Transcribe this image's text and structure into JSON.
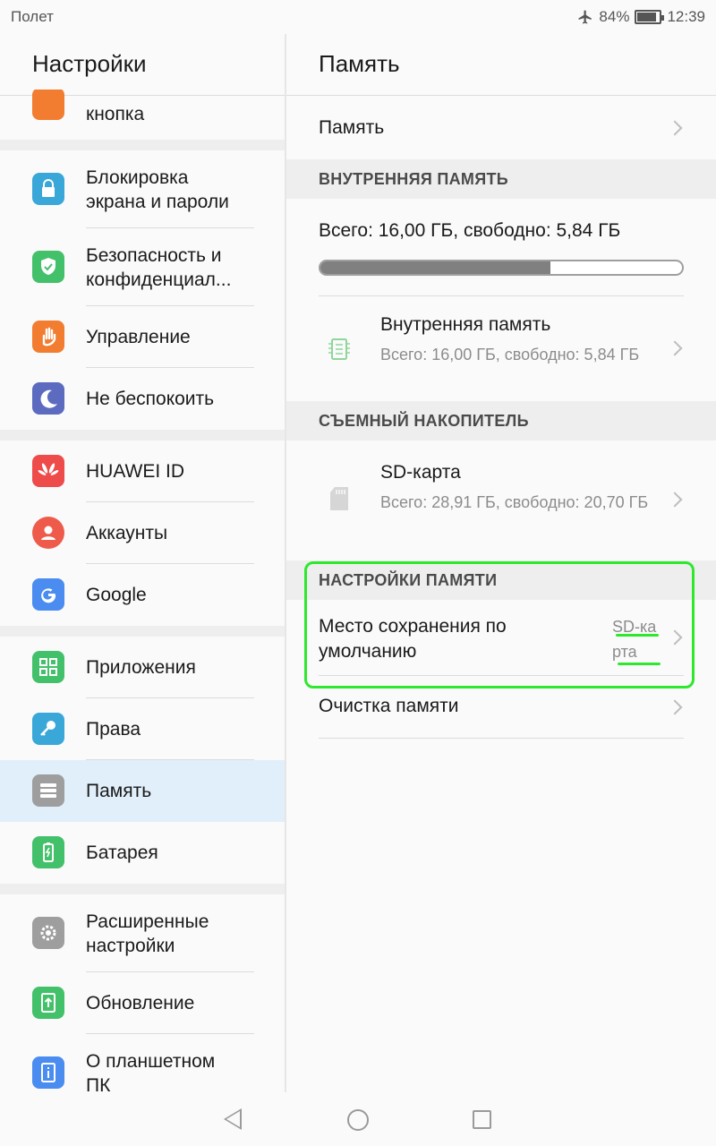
{
  "status_bar": {
    "left_text": "Полет",
    "battery": "84%",
    "time": "12:39",
    "battery_level": 0.84
  },
  "left_pane": {
    "title": "Настройки",
    "partial_item_label": "кнопка",
    "groups": [
      [
        {
          "label_line1": "Блокировка",
          "label_line2": "экрана и пароли",
          "icon": "lock-icon",
          "color": "#3aa7d9"
        },
        {
          "label_line1": "Безопасность и",
          "label_line2": "конфиденциал...",
          "icon": "shield-check-icon",
          "color": "#43c16a"
        },
        {
          "label": "Управление",
          "icon": "hand-icon",
          "color": "#f27c30"
        },
        {
          "label": "Не беспокоить",
          "icon": "moon-icon",
          "color": "#5c6bc0"
        }
      ],
      [
        {
          "label": "HUAWEI ID",
          "icon": "huawei-logo-icon",
          "color": "#ee4b4b"
        },
        {
          "label": "Аккаунты",
          "icon": "account-icon",
          "color": "#ee5b4b"
        },
        {
          "label": "Google",
          "icon": "google-icon",
          "color": "#4a8cf0"
        }
      ],
      [
        {
          "label": "Приложения",
          "icon": "apps-grid-icon",
          "color": "#43c16a"
        },
        {
          "label": "Права",
          "icon": "key-icon",
          "color": "#3aa7d9"
        },
        {
          "label": "Память",
          "icon": "storage-icon",
          "color": "#9e9e9e",
          "selected": true
        },
        {
          "label": "Батарея",
          "icon": "battery-icon",
          "color": "#43c16a"
        }
      ],
      [
        {
          "label_line1": "Расширенные",
          "label_line2": "настройки",
          "icon": "gear-icon",
          "color": "#9e9e9e"
        },
        {
          "label": "Обновление",
          "icon": "update-icon",
          "color": "#43c16a"
        },
        {
          "label_line1": "О планшетном",
          "label_line2": "ПК",
          "icon": "info-icon",
          "color": "#4a8cf0"
        }
      ]
    ]
  },
  "right_pane": {
    "title": "Память",
    "memory_row": "Память",
    "internal_header": "ВНУТРЕННЯЯ ПАМЯТЬ",
    "internal_summary": "Всего: 16,00 ГБ, свободно: 5,84 ГБ",
    "internal_used_fraction": 0.635,
    "internal_item_title": "Внутренняя память",
    "internal_item_sub": "Всего: 16,00 ГБ, свободно: 5,84 ГБ",
    "removable_header": "СЪЕМНЫЙ НАКОПИТЕЛЬ",
    "sd_title": "SD-карта",
    "sd_sub": "Всего: 28,91 ГБ, свободно: 20,70 ГБ",
    "settings_header": "НАСТРОЙКИ ПАМЯТИ",
    "default_location_label": "Место сохранения по умолчанию",
    "default_location_value": "SD-карта",
    "cleanup_label": "Очистка памяти"
  }
}
